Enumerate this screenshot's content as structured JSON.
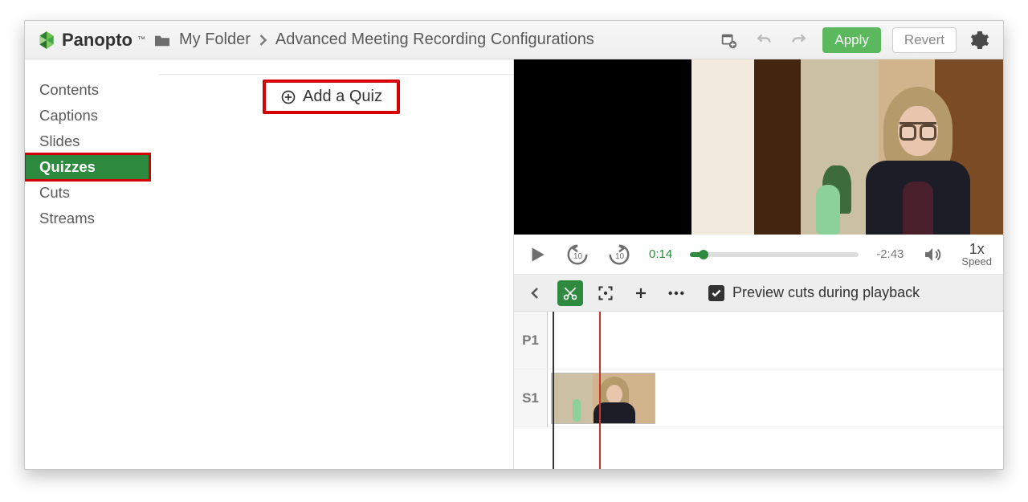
{
  "brand": "Panopto",
  "breadcrumbs": {
    "folder": "My Folder",
    "title": "Advanced Meeting Recording Configurations"
  },
  "toolbar": {
    "apply": "Apply",
    "revert": "Revert"
  },
  "sidebar": {
    "items": [
      {
        "label": "Contents"
      },
      {
        "label": "Captions"
      },
      {
        "label": "Slides"
      },
      {
        "label": "Quizzes",
        "active": true
      },
      {
        "label": "Cuts"
      },
      {
        "label": "Streams"
      }
    ]
  },
  "quiz": {
    "add_label": "Add a Quiz"
  },
  "playback": {
    "current": "0:14",
    "remaining": "-2:43",
    "progress_pct": 8,
    "speed_value": "1x",
    "speed_label": "Speed"
  },
  "edit": {
    "preview_label": "Preview cuts during playback",
    "preview_checked": true
  },
  "tracks": [
    {
      "label": "P1",
      "has_thumb": false
    },
    {
      "label": "S1",
      "has_thumb": true
    }
  ],
  "icons": {
    "folder": "folder-icon",
    "chevron": "chevron-right-icon",
    "calendar": "calendar-add-icon",
    "undo": "undo-icon",
    "redo": "redo-icon",
    "gear": "gear-icon",
    "plus_circle": "plus-circle-icon",
    "play": "play-icon",
    "rewind10": "rewind-10-icon",
    "forward10": "forward-10-icon",
    "volume": "volume-icon",
    "back": "back-icon",
    "cut": "cut-icon",
    "focus": "focus-icon",
    "plus": "plus-icon",
    "more": "more-icon",
    "check": "check-icon"
  }
}
